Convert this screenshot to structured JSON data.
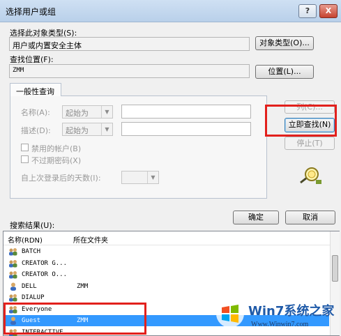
{
  "window": {
    "title": "选择用户或组",
    "help_label": "?",
    "close_label": "X"
  },
  "object_type": {
    "label": "选择此对象类型(S):",
    "value": "用户或内置安全主体",
    "button": "对象类型(O)..."
  },
  "location": {
    "label": "查找位置(F):",
    "value": "ZMM",
    "button": "位置(L)..."
  },
  "query_tab": {
    "label": "一般性查询"
  },
  "query": {
    "name_label": "名称(A):",
    "name_mode": "起始为",
    "name_value": "",
    "desc_label": "描述(D):",
    "desc_mode": "起始为",
    "desc_value": "",
    "disabled_accounts_label": "禁用的帐户(B)",
    "non_expiring_label": "不过期密码(X)",
    "days_label": "自上次登录后的天数(I):",
    "days_value": ""
  },
  "side_buttons": {
    "columns": "列(C)...",
    "find_now": "立即查找(N)",
    "stop": "停止(T)"
  },
  "footer_buttons": {
    "ok": "确定",
    "cancel": "取消"
  },
  "results": {
    "label": "搜索结果(U):",
    "columns": [
      "名称(RDN)",
      "所在文件夹"
    ],
    "rows": [
      {
        "name": "BATCH",
        "folder": "",
        "icon": "group-icon"
      },
      {
        "name": "CREATOR G...",
        "folder": "",
        "icon": "group-icon"
      },
      {
        "name": "CREATOR O...",
        "folder": "",
        "icon": "group-icon"
      },
      {
        "name": "DELL",
        "folder": "ZMM",
        "icon": "user-icon"
      },
      {
        "name": "DIALUP",
        "folder": "",
        "icon": "group-icon"
      },
      {
        "name": "Everyone",
        "folder": "",
        "icon": "group-icon"
      },
      {
        "name": "Guest",
        "folder": "ZMM",
        "icon": "user-icon",
        "selected": true
      },
      {
        "name": "INTERACTIVE",
        "folder": "",
        "icon": "group-icon"
      }
    ]
  },
  "watermark": {
    "brand": "Win7系统之家",
    "url": "Www.Winwin7.com"
  },
  "colors": {
    "highlight": "#e2201c",
    "selection": "#3399ff"
  }
}
